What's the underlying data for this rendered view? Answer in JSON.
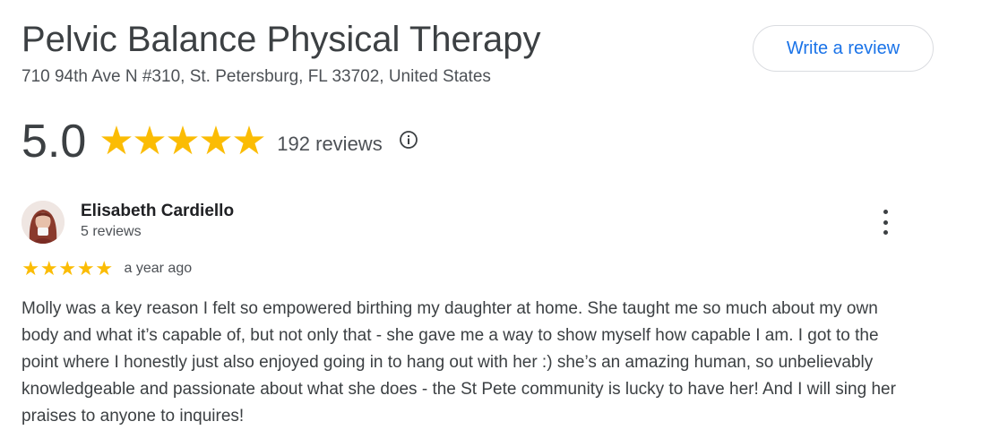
{
  "business": {
    "name": "Pelvic Balance Physical Therapy",
    "address": "710 94th Ave N #310, St. Petersburg, FL 33702, United States"
  },
  "actions": {
    "write_review_label": "Write a review"
  },
  "summary": {
    "rating": "5.0",
    "stars": 5,
    "review_count_label": "192 reviews",
    "info_icon": "info-circle-icon"
  },
  "review": {
    "author": "Elisabeth Cardiello",
    "author_meta": "5 reviews",
    "stars": 5,
    "date": "a year ago",
    "text": "Molly was a key reason I felt so empowered birthing my daughter at home. She taught me so much about my own body and what it’s capable of, but not only that - she gave me a way to show myself how capable I am. I got to the point where I honestly just also enjoyed going in to hang out with her :) she’s an amazing human, so unbelievably knowledgeable and passionate about what she does - the St Pete community is lucky to have her! And I will sing her praises to anyone to inquires!",
    "more_icon": "more-vert-icon"
  },
  "colors": {
    "star": "#fbbc04",
    "link_blue": "#1a73e8",
    "text_primary": "#202124",
    "text_secondary": "#4d5156"
  }
}
